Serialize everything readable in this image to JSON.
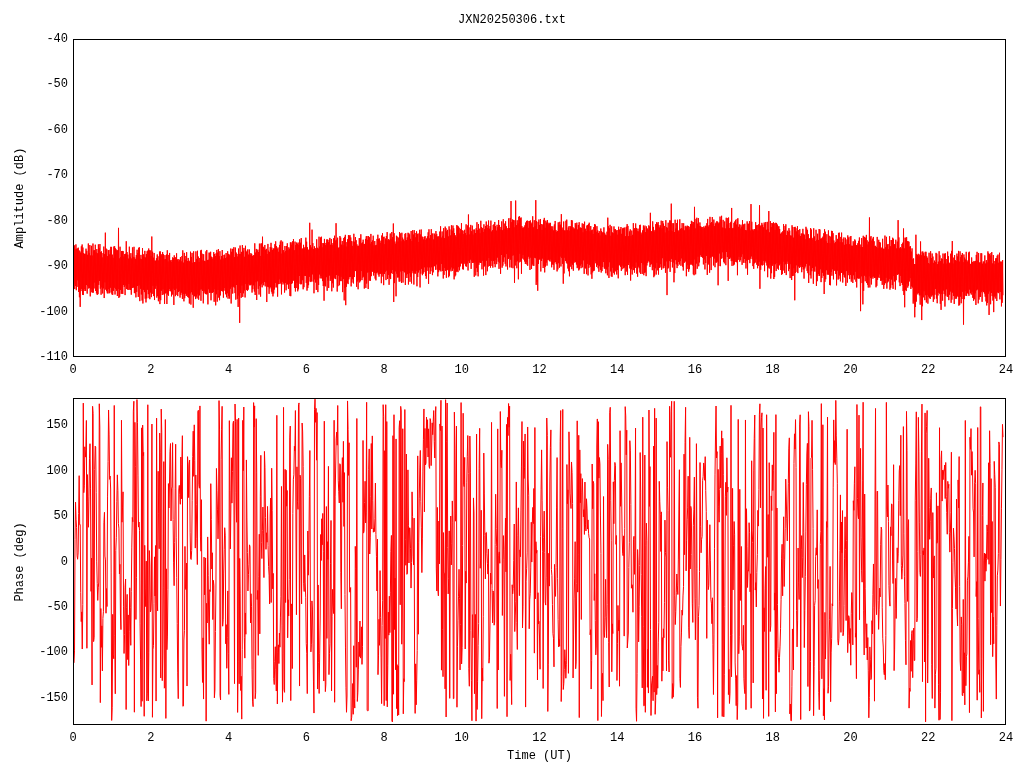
{
  "title": "JXN20250306.txt",
  "plots": [
    {
      "kind": "amplitude",
      "ylabel": "Amplitude (dB)",
      "yticks": [
        "-40",
        "-50",
        "-60",
        "-70",
        "-80",
        "-90",
        "-100",
        "-110"
      ],
      "xticks": [
        "0",
        "2",
        "4",
        "6",
        "8",
        "10",
        "12",
        "14",
        "16",
        "18",
        "20",
        "22",
        "24"
      ]
    },
    {
      "kind": "phase",
      "ylabel": "Phase (deg)",
      "yticks": [
        "150",
        "100",
        "50",
        "0",
        "-50",
        "-100",
        "-150"
      ],
      "xticks": [
        "0",
        "2",
        "4",
        "6",
        "8",
        "10",
        "12",
        "14",
        "16",
        "18",
        "20",
        "22",
        "24"
      ]
    }
  ],
  "xlabel": "Time (UT)"
}
